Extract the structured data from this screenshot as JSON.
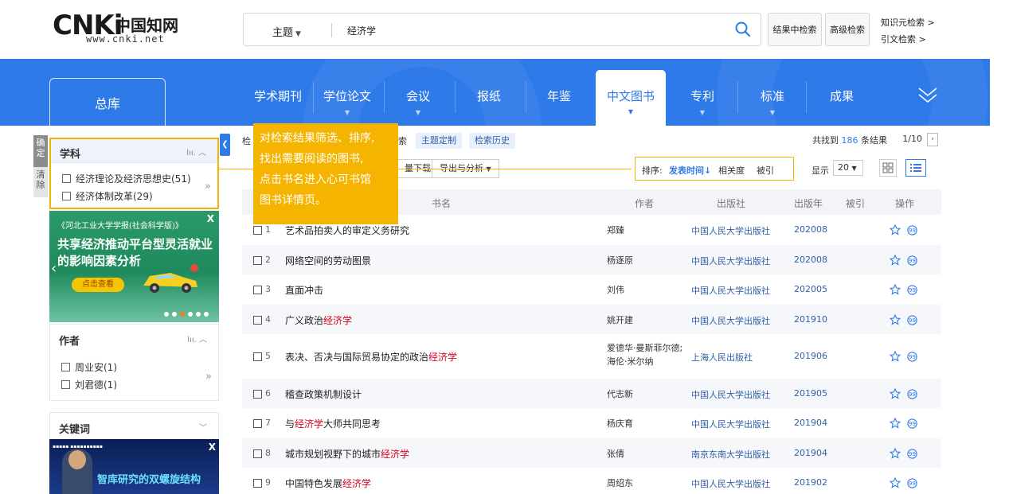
{
  "header": {
    "logo_mark": "CNKi",
    "logo_cn": "中国知网",
    "logo_url": "www.cnki.net",
    "search": {
      "scope": "主题",
      "query": "经济学"
    },
    "buttons": {
      "search_in_results": "结果中检索",
      "advanced": "高级检索"
    },
    "links": {
      "knowledge": "知识元检索 >",
      "citation": "引文检索 >"
    }
  },
  "nav": {
    "main": "总库",
    "tabs": [
      "学术期刊",
      "学位论文",
      "会议",
      "报纸",
      "年鉴",
      "中文图书",
      "专利",
      "标准",
      "成果"
    ],
    "active_tab": "中文图书"
  },
  "sidebar": {
    "confirm": "确定",
    "clear": "清除",
    "subject": {
      "title": "学科",
      "items": [
        "经济理论及经济思想史(51)",
        "经济体制改革(29)"
      ]
    },
    "ad1": {
      "header": "《河北工业大学学报(社会科学版)》",
      "headline": "共享经济推动平台型灵活就业的影响因素分析",
      "button": "点击查看",
      "close": "X"
    },
    "author": {
      "title": "作者",
      "items": [
        "周业安(1)",
        "刘君德(1)"
      ]
    },
    "keyword": {
      "title": "关键词"
    },
    "ad2": {
      "headline": "智库研究的双螺旋结构",
      "close": "X"
    }
  },
  "results": {
    "toolbar1": {
      "prefix": "检",
      "suffix": "索",
      "chips": [
        "主题定制",
        "检索历史"
      ],
      "found_label_pre": "共找到",
      "found_count": "186",
      "found_label_post": "条结果",
      "page": "1/10"
    },
    "toolbar2": {
      "download": "量下载",
      "export": "导出与分析",
      "sort_label": "排序:",
      "sort_active": "发表时间",
      "sort_relevance": "相关度",
      "sort_cited": "被引",
      "show_label": "显示",
      "page_size": "20"
    },
    "columns": {
      "title": "书名",
      "author": "作者",
      "publisher": "出版社",
      "year": "出版年",
      "cited": "被引",
      "ops": "操作"
    },
    "rows": [
      {
        "idx": "1",
        "title_pre": "艺术品拍卖人的审定义务研究",
        "hl": "",
        "title_post": "",
        "author": "郑臻",
        "pub": "中国人民大学出版社",
        "year": "202008"
      },
      {
        "idx": "2",
        "title_pre": "网络空间的劳动图景",
        "hl": "",
        "title_post": "",
        "author": "杨逐原",
        "pub": "中国人民大学出版社",
        "year": "202008"
      },
      {
        "idx": "3",
        "title_pre": "直面冲击",
        "hl": "",
        "title_post": "",
        "author": "刘伟",
        "pub": "中国人民大学出版社",
        "year": "202005"
      },
      {
        "idx": "4",
        "title_pre": "广义政治",
        "hl": "经济学",
        "title_post": "",
        "author": "姚开建",
        "pub": "中国人民大学出版社",
        "year": "201910"
      },
      {
        "idx": "5",
        "title_pre": "表决、否决与国际贸易协定的政治",
        "hl": "经济学",
        "title_post": "",
        "author": "爱德华·曼斯菲尔德; 海伦·米尔纳",
        "pub": "上海人民出版社",
        "year": "201906"
      },
      {
        "idx": "6",
        "title_pre": "稽查政策机制设计",
        "hl": "",
        "title_post": "",
        "author": "代志新",
        "pub": "中国人民大学出版社",
        "year": "201905"
      },
      {
        "idx": "7",
        "title_pre": "与",
        "hl": "经济学",
        "title_post": "大师共同思考",
        "author": "杨庆育",
        "pub": "中国人民大学出版社",
        "year": "201904"
      },
      {
        "idx": "8",
        "title_pre": "城市规划视野下的城市",
        "hl": "经济学",
        "title_post": "",
        "author": "张倩",
        "pub": "南京东南大学出版社",
        "year": "201904"
      },
      {
        "idx": "9",
        "title_pre": "中国特色发展",
        "hl": "经济学",
        "title_post": "",
        "author": "周绍东",
        "pub": "中国人民大学出版社",
        "year": "201902"
      }
    ]
  },
  "tooltip": {
    "lines": [
      "对检索结果筛选、排序,",
      "找出需要阅读的图书,",
      "点击书名进入心可书馆",
      "图书详情页。"
    ]
  },
  "colors": {
    "brand_blue": "#2f7ae9",
    "highlight_red": "#d9001b",
    "callout_yellow": "#f4b400"
  }
}
